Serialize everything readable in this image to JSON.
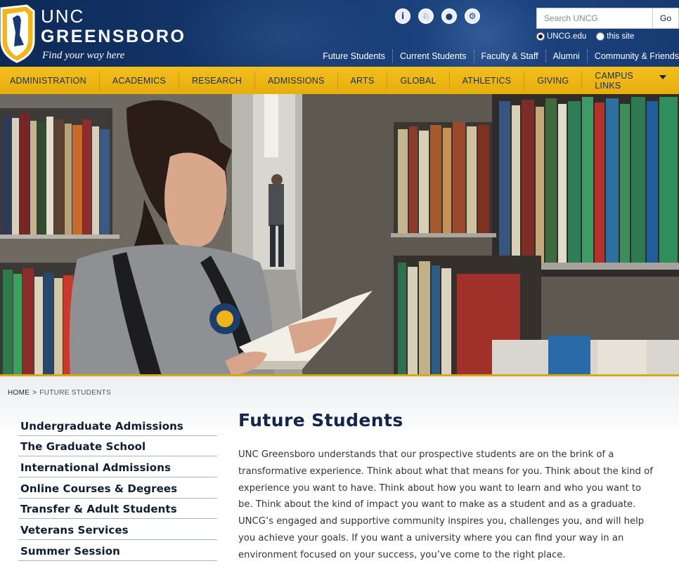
{
  "brand": {
    "line1": "UNC",
    "line2": "GREENSBORO",
    "tagline": "Find your way here"
  },
  "utility_icons": [
    {
      "name": "info-icon",
      "glyph": "i"
    },
    {
      "name": "bird-icon",
      "glyph": "♘"
    },
    {
      "name": "user-icon",
      "glyph": "●"
    },
    {
      "name": "gear-icon",
      "glyph": "⚙"
    }
  ],
  "search": {
    "placeholder": "Search UNCG",
    "go_label": "Go",
    "scope_options": [
      {
        "label": "UNCG.edu",
        "checked": true
      },
      {
        "label": "this site",
        "checked": false
      }
    ]
  },
  "audience_links": [
    "Future Students",
    "Current Students",
    "Faculty & Staff",
    "Alumni",
    "Community & Friends"
  ],
  "main_nav": [
    "ADMINISTRATION",
    "ACADEMICS",
    "RESEARCH",
    "ADMISSIONS",
    "ARTS",
    "GLOBAL",
    "ATHLETICS",
    "GIVING",
    "CAMPUS LINKS"
  ],
  "breadcrumb": {
    "home": "HOME",
    "separator": ">",
    "current": "FUTURE STUDENTS"
  },
  "sidebar": {
    "items": [
      "Undergraduate Admissions",
      "The Graduate School",
      "International Admissions",
      "Online Courses & Degrees",
      "Transfer & Adult Students",
      "Veterans Services",
      "Summer Session"
    ]
  },
  "main": {
    "title": "Future Students",
    "intro": "UNC Greensboro understands that our prospective students are on the brink of a transformative experience. Think about what that means for you. Think about the kind of experience you want to have. Think about how you want to learn and who you want to be. Think about the kind of impact you want to make as a student and as a graduate. UNCG’s engaged and supportive community inspires you, challenges you, and will help you achieve your goals. If you want a university where you can find your way in an environment focused on your success, you’ve come to the right place."
  },
  "colors": {
    "header_navy": "#173a72",
    "nav_gold": "#f0b91a",
    "title_navy": "#13254b"
  }
}
